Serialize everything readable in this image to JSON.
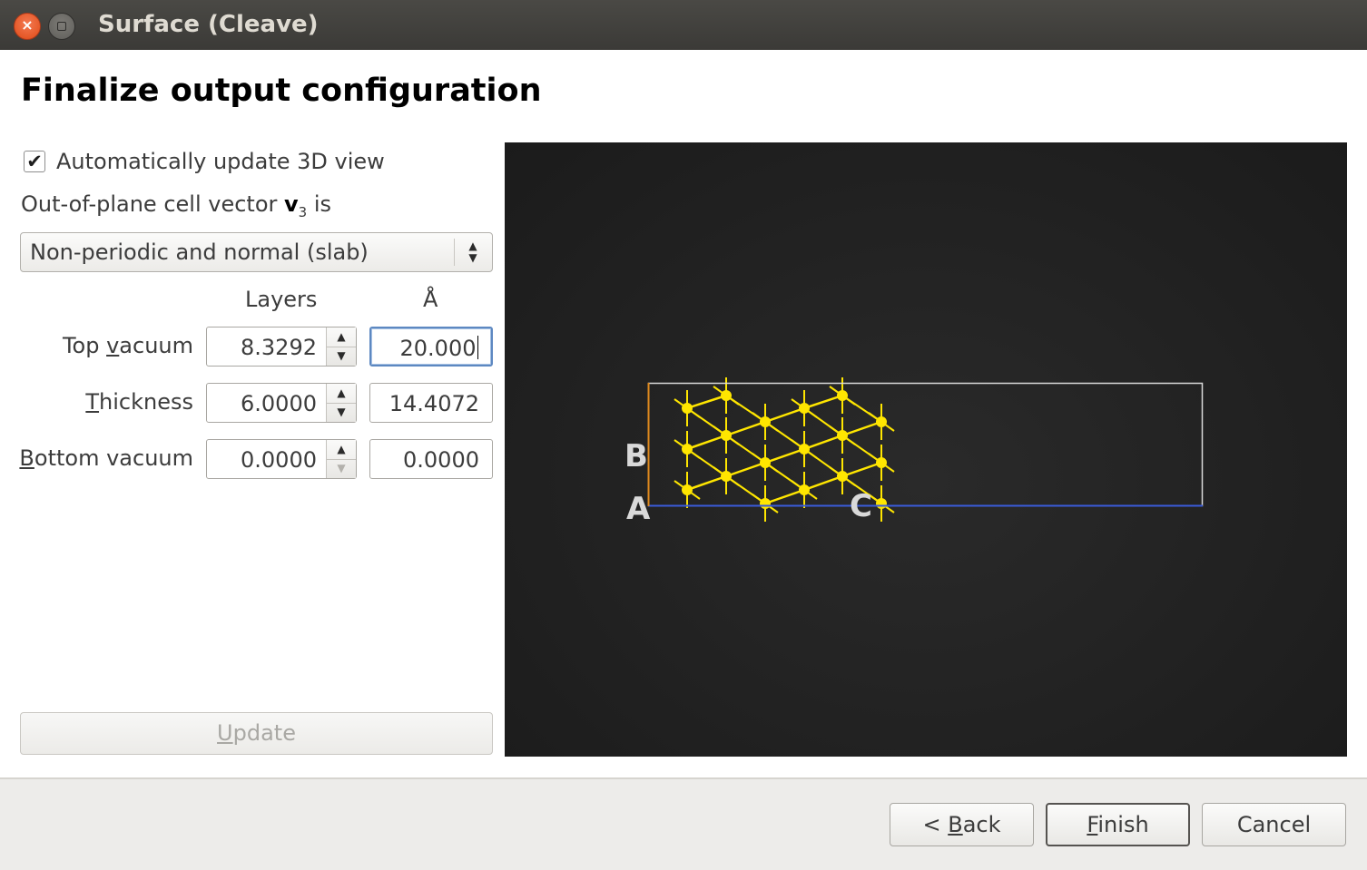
{
  "window": {
    "title": "Surface (Cleave)",
    "close_glyph": "×"
  },
  "page": {
    "heading": "Finalize output configuration"
  },
  "options": {
    "auto_update_checked": true,
    "check_glyph": "✔",
    "auto_update_label": "Automatically update 3D view",
    "vector_label_pre": "Out-of-plane cell vector ",
    "vector_symbol": "v",
    "vector_sub": "3",
    "vector_label_post": " is",
    "vector_mode": "Non-periodic and normal (slab)"
  },
  "table": {
    "col_layers": "Layers",
    "col_angstrom": "Å",
    "rows": [
      {
        "label_pre": "Top ",
        "label_key": "v",
        "label_post": "acuum",
        "layers": "8.3292",
        "angstrom": "20.000"
      },
      {
        "label_pre": "",
        "label_key": "T",
        "label_post": "hickness",
        "layers": "6.0000",
        "angstrom": "14.4072"
      },
      {
        "label_pre": "",
        "label_key": "B",
        "label_post": "ottom vacuum",
        "layers": "0.0000",
        "angstrom": "0.0000"
      }
    ]
  },
  "update_button": {
    "key": "U",
    "rest": "pdate"
  },
  "viewport": {
    "axis_labels": {
      "a": "A",
      "b": "B",
      "c": "C"
    },
    "atom_color": "#ffe600",
    "cell_color": "#d9d9d9",
    "a_axis_color": "#3a5bd9",
    "b_axis_color": "#e08a1e"
  },
  "footer": {
    "back": {
      "pre": "< ",
      "key": "B",
      "rest": "ack"
    },
    "finish": {
      "key": "F",
      "rest": "inish"
    },
    "cancel": "Cancel"
  }
}
